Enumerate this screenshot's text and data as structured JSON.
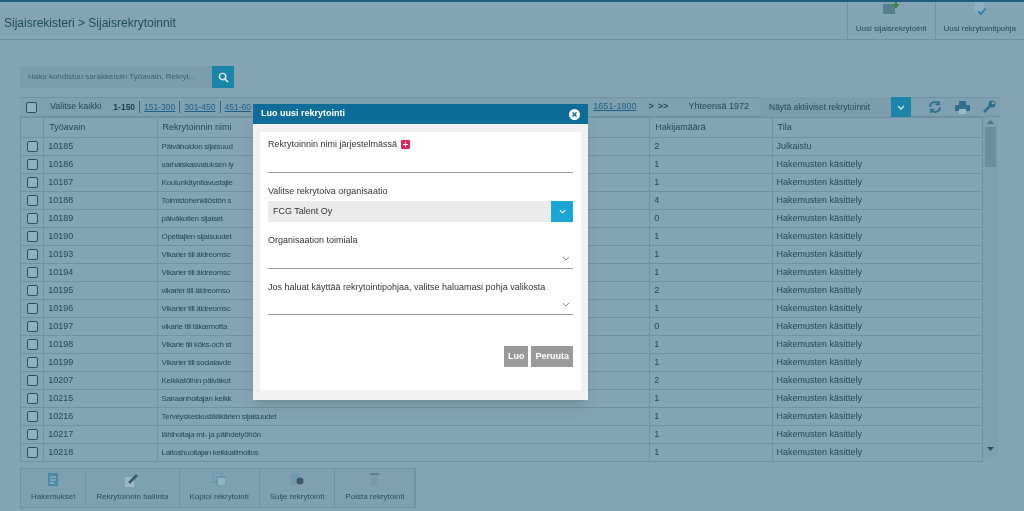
{
  "breadcrumb": "Sijaisrekisteri > Sijaisrekrytoinnit",
  "header_actions": [
    {
      "label": "Uusi sijaisrekrytointi",
      "kind": "new"
    },
    {
      "label": "Uusi rekrytointipohja",
      "kind": "template"
    }
  ],
  "search": {
    "placeholder": "Haku kohdistuu sarakkeisiin Työavain, Rekryt..."
  },
  "toolbar": {
    "select_all": {
      "label": "Valitse kaikki",
      "checked": false
    },
    "pages": [
      {
        "label": "1-150",
        "selected": true
      },
      {
        "label": "151-300",
        "selected": false
      },
      {
        "label": "301-450",
        "selected": false
      },
      {
        "label": "451-60",
        "selected": false
      }
    ],
    "pages_end": [
      {
        "label": "1651-1800",
        "selected": false
      }
    ],
    "next": ">",
    "last": ">>",
    "total": "Yhteensä 1972",
    "filter": "Näytä aktiiviset rekrytoinnit"
  },
  "table": {
    "columns": [
      "Työavain",
      "Rekrytoinnin nimi",
      "Hakijamäärä",
      "Tila"
    ],
    "rows": [
      {
        "checked": false,
        "cells": [
          "10185",
          "Päivähoidon sijaisuud",
          "2",
          "Julkaistu"
        ]
      },
      {
        "checked": false,
        "cells": [
          "10186",
          "varhaiskasvatuksen ly",
          "1",
          "Hakemusten käsittely"
        ]
      },
      {
        "checked": false,
        "cells": [
          "10187",
          "Koulunkäyntiavustajie",
          "1",
          "Hakemusten käsittely"
        ]
      },
      {
        "checked": false,
        "cells": [
          "10188",
          "Toimistohenkilöstön s",
          "4",
          "Hakemusten käsittely"
        ]
      },
      {
        "checked": false,
        "cells": [
          "10189",
          "päiväkotien sijaiset",
          "0",
          "Hakemusten käsittely"
        ]
      },
      {
        "checked": false,
        "cells": [
          "10190",
          "Opettajien sijaisuudet",
          "1",
          "Hakemusten käsittely"
        ]
      },
      {
        "checked": false,
        "cells": [
          "10193",
          "Vikarier till äldreomsc",
          "1",
          "Hakemusten käsittely"
        ]
      },
      {
        "checked": false,
        "cells": [
          "10194",
          "Vikarier till äldreomsc",
          "1",
          "Hakemusten käsittely"
        ]
      },
      {
        "checked": false,
        "cells": [
          "10195",
          "vikarier till äldreomso",
          "2",
          "Hakemusten käsittely"
        ]
      },
      {
        "checked": false,
        "cells": [
          "10196",
          "Vikarier till äldreomsc",
          "1",
          "Hakemusten käsittely"
        ]
      },
      {
        "checked": false,
        "cells": [
          "10197",
          "vikarie till läkarmotta",
          "0",
          "Hakemusten käsittely"
        ]
      },
      {
        "checked": false,
        "cells": [
          "10198",
          "Vikarie till köks-och st",
          "1",
          "Hakemusten käsittely"
        ]
      },
      {
        "checked": false,
        "cells": [
          "10199",
          "Vikarier till socialavde",
          "1",
          "Hakemusten käsittely"
        ]
      },
      {
        "checked": false,
        "cells": [
          "10207",
          "Keikkatöihin päiväkot",
          "2",
          "Hakemusten käsittely"
        ]
      },
      {
        "checked": false,
        "cells": [
          "10215",
          "Sairaanhoitajan keikk",
          "1",
          "Hakemusten käsittely"
        ]
      },
      {
        "checked": false,
        "cells": [
          "10216",
          "Terveyskeskuslääkärien sijaisuudet",
          "1",
          "Hakemusten käsittely"
        ]
      },
      {
        "checked": false,
        "cells": [
          "10217",
          "lähihoitaja mt- ja päihdetyöhön",
          "1",
          "Hakemusten käsittely"
        ]
      },
      {
        "checked": false,
        "cells": [
          "10218",
          "Laitoshuoltajan keikkailmoitus",
          "1",
          "Hakemusten käsittely"
        ]
      }
    ]
  },
  "bottom_actions": [
    {
      "label": "Hakemukset",
      "kind": "doc"
    },
    {
      "label": "Rekrytoinnin hallinta",
      "kind": "edit"
    },
    {
      "label": "Kopioi rekrytointi",
      "kind": "copy"
    },
    {
      "label": "Sulje rekrytointi",
      "kind": "close"
    },
    {
      "label": "Poista rekrytointi",
      "kind": "delete"
    }
  ],
  "dialog": {
    "title": "Luo uusi rekrytointi",
    "fields": [
      {
        "kind": "text",
        "label": "Rekrytoinnin nimi järjestelmässä",
        "required": true
      },
      {
        "kind": "select",
        "label": "Valitse rekrytoiva organisaatio",
        "value": "FCG Talent Oy"
      },
      {
        "kind": "dropdown",
        "label": "Organisaation toimiala"
      },
      {
        "kind": "dropdown",
        "label": "Jos haluat käyttää rekrytointipohjaa, valitse haluamasi pohja valikosta"
      }
    ],
    "buttons": [
      "Luo",
      "Peruuta"
    ]
  }
}
